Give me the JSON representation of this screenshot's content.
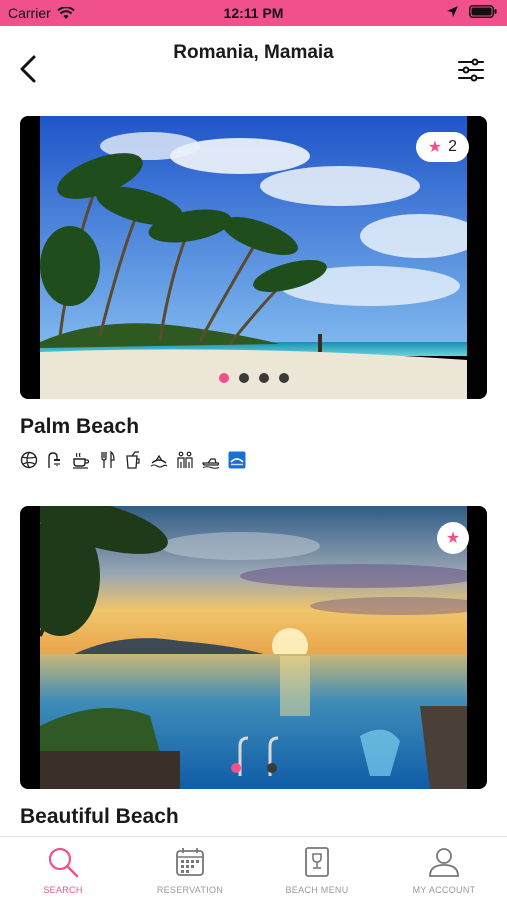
{
  "status_bar": {
    "carrier": "Carrier",
    "time": "12:11 PM"
  },
  "header": {
    "title": "Romania, Mamaia"
  },
  "colors": {
    "accent": "#f0508c",
    "status_bar_bg": "#f0508c",
    "inactive": "#9a9a9a"
  },
  "cards": [
    {
      "name": "Palm Beach",
      "rating": "2",
      "pager": {
        "count": 4,
        "active": 0
      },
      "amenities": [
        "volleyball-icon",
        "shower-icon",
        "coffee-icon",
        "restaurant-icon",
        "drink-icon",
        "boat-icon",
        "family-icon",
        "jetski-icon",
        "blue-flag-icon"
      ]
    },
    {
      "name": "Beautiful Beach",
      "rating": "",
      "pager": {
        "count": 2,
        "active": 0
      }
    }
  ],
  "tabs": [
    {
      "label": "SEARCH",
      "icon": "search-icon",
      "active": true
    },
    {
      "label": "RESERVATION",
      "icon": "calendar-icon",
      "active": false
    },
    {
      "label": "BEACH MENU",
      "icon": "menu-card-icon",
      "active": false
    },
    {
      "label": "MY ACCOUNT",
      "icon": "user-icon",
      "active": false
    }
  ]
}
